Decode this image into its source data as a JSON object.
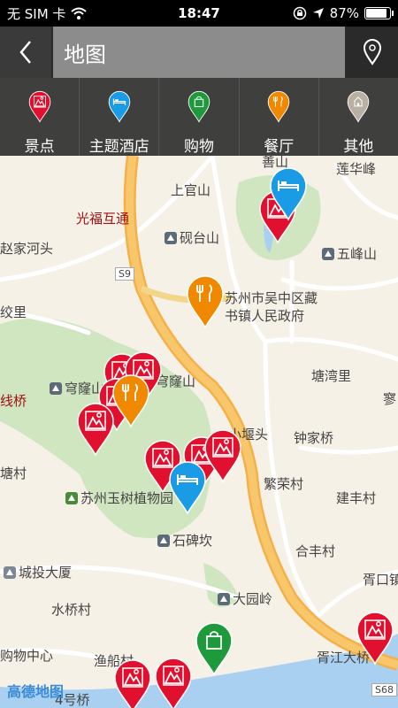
{
  "status": {
    "carrier": "无 SIM 卡",
    "time": "18:47",
    "battery": "87%",
    "battery_level": 0.87
  },
  "nav": {
    "title": "地图"
  },
  "categories": [
    {
      "label": "景点",
      "icon": "scenic-spot-icon",
      "color": "#e0102e"
    },
    {
      "label": "主题酒店",
      "icon": "hotel-icon",
      "color": "#1a9be6"
    },
    {
      "label": "购物",
      "icon": "shopping-icon",
      "color": "#1e9a3c"
    },
    {
      "label": "餐厅",
      "icon": "restaurant-icon",
      "color": "#f08800"
    },
    {
      "label": "其他",
      "icon": "other-icon",
      "color": "#b9b0a4"
    }
  ],
  "map": {
    "places": [
      "善山",
      "莲华峰",
      "上官山",
      "光福互通",
      "砚台山",
      "五峰山",
      "赵家河头",
      "苏州市吴中区藏",
      "书镇人民政府",
      "绞里",
      "塘湾里",
      "穹窿山",
      "穹窿山",
      "寥",
      "线桥",
      "钟家桥",
      "小堰头",
      "塘村",
      "繁荣村",
      "苏州玉树植物园",
      "建丰村",
      "石碑坎",
      "合丰村",
      "城投大厦",
      "胥口镇",
      "大园岭",
      "水桥村",
      "胥江大桥",
      "购物中心",
      "渔船村",
      "4号桥",
      "S9",
      "S68"
    ],
    "logo": "高德地图"
  }
}
